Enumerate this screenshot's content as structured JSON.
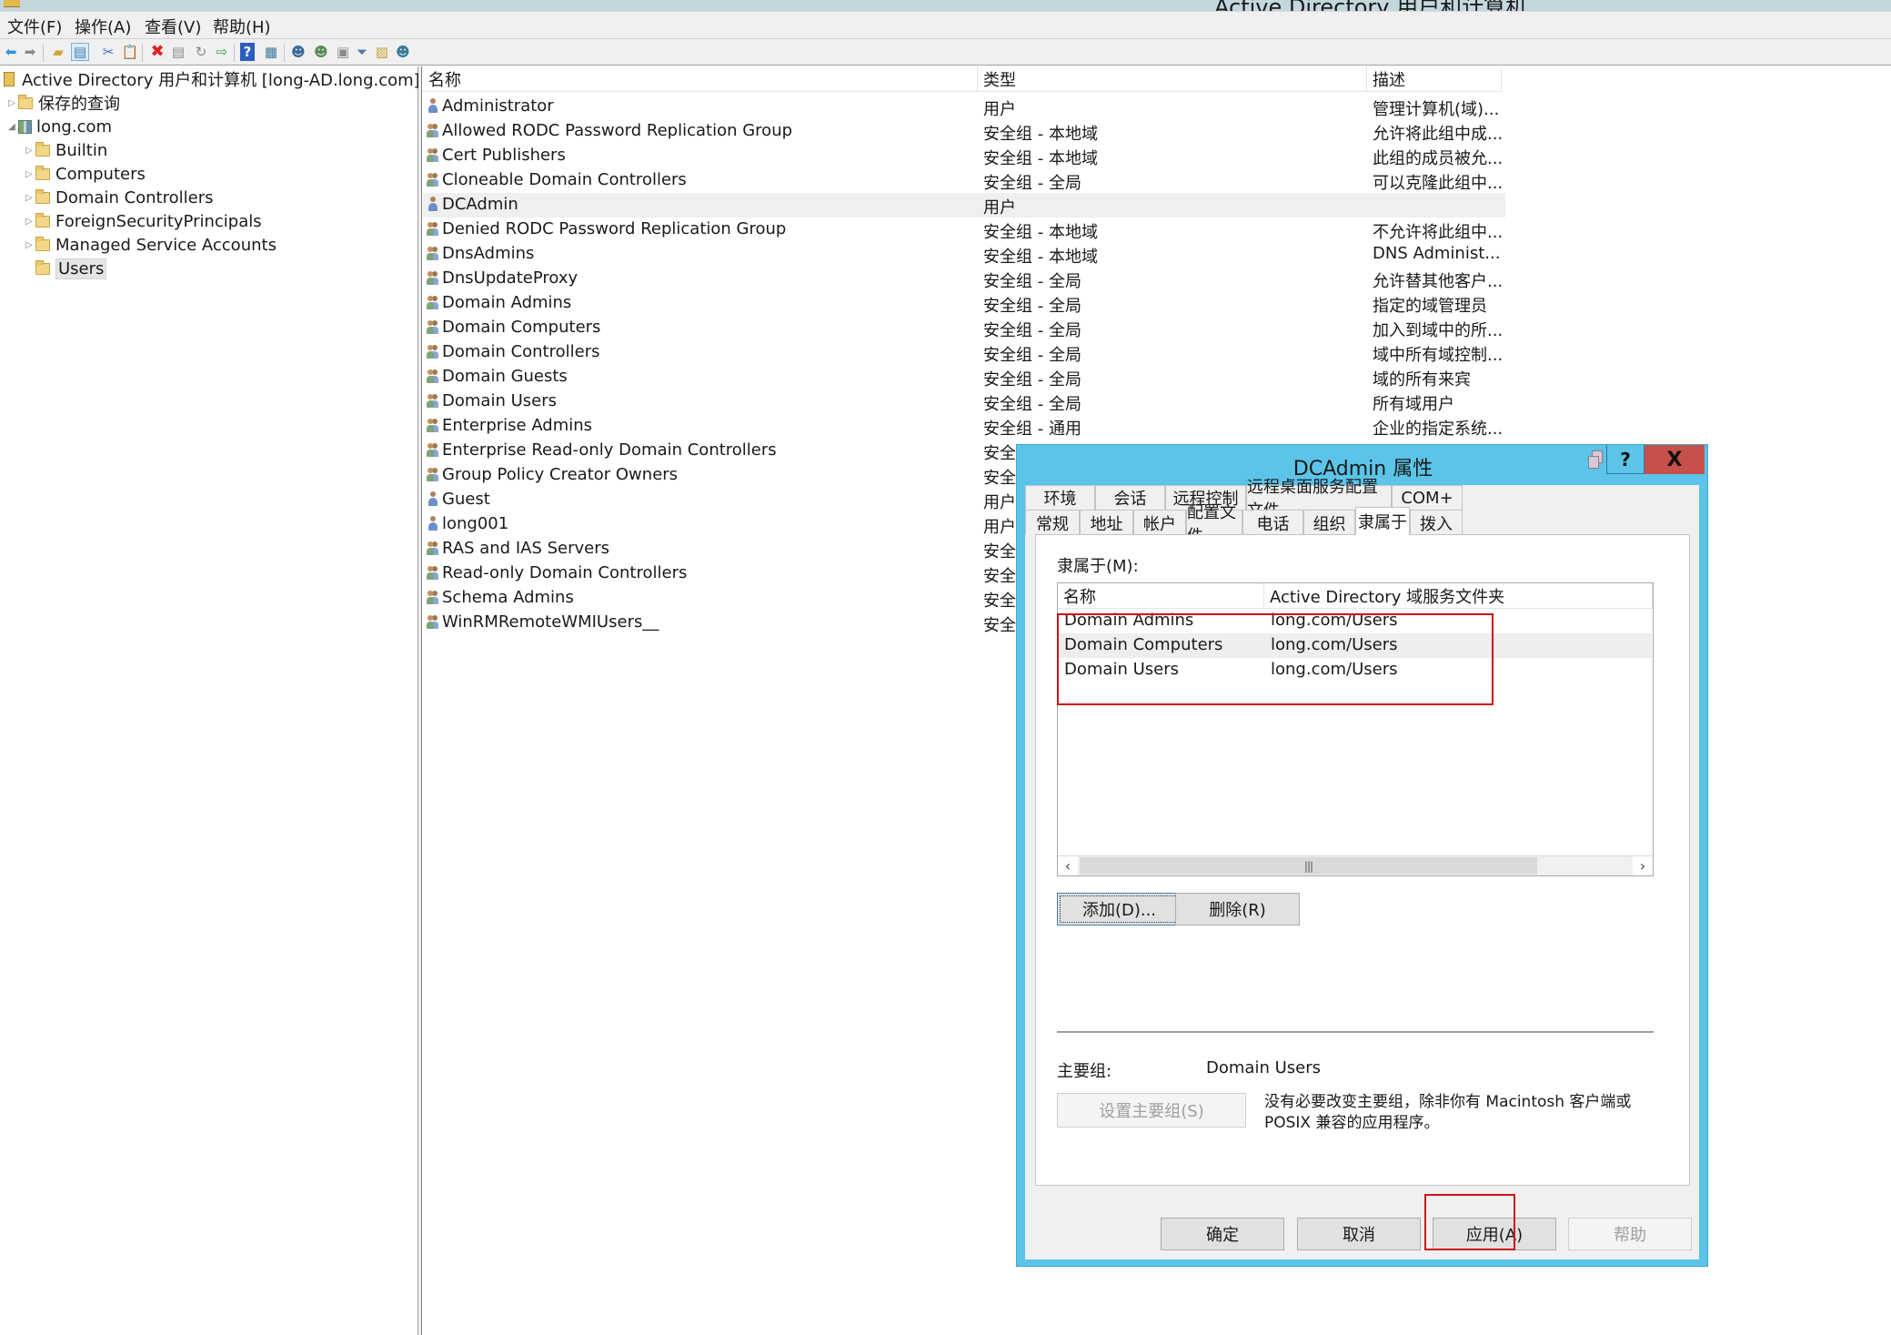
{
  "window": {
    "title": "Active Directory 用户和计算机"
  },
  "menu": [
    "文件(F)",
    "操作(A)",
    "查看(V)",
    "帮助(H)"
  ],
  "toolbar": {
    "icons": [
      "back-icon",
      "forward-icon",
      "up-folder-icon",
      "show-hide-console-tree-icon",
      "cut-icon",
      "paste-icon",
      "delete-icon",
      "properties-icon",
      "refresh-icon",
      "export-list-icon",
      "help-icon",
      "show-action-pane-icon",
      "new-user-icon",
      "new-group-icon",
      "new-ou-icon",
      "filter-icon",
      "find-icon",
      "add-to-group-icon"
    ]
  },
  "tree": {
    "root": "Active Directory 用户和计算机 [long-AD.long.com]",
    "saved_queries": "保存的查询",
    "domain": "long.com",
    "children": [
      "Builtin",
      "Computers",
      "Domain Controllers",
      "ForeignSecurityPrincipals",
      "Managed Service Accounts",
      "Users"
    ],
    "selected": "Users"
  },
  "list": {
    "columns": [
      "名称",
      "类型",
      "描述"
    ],
    "rows": [
      {
        "name": "Administrator",
        "icon": "user",
        "type": "用户",
        "desc": "管理计算机(域)..."
      },
      {
        "name": "Allowed RODC Password Replication Group",
        "icon": "group",
        "type": "安全组 - 本地域",
        "desc": "允许将此组中成..."
      },
      {
        "name": "Cert Publishers",
        "icon": "group",
        "type": "安全组 - 本地域",
        "desc": "此组的成员被允..."
      },
      {
        "name": "Cloneable Domain Controllers",
        "icon": "group",
        "type": "安全组 - 全局",
        "desc": "可以克隆此组中..."
      },
      {
        "name": "DCAdmin",
        "icon": "user",
        "type": "用户",
        "desc": "",
        "selected": true
      },
      {
        "name": "Denied RODC Password Replication Group",
        "icon": "group",
        "type": "安全组 - 本地域",
        "desc": "不允许将此组中..."
      },
      {
        "name": "DnsAdmins",
        "icon": "group",
        "type": "安全组 - 本地域",
        "desc": "DNS Administ..."
      },
      {
        "name": "DnsUpdateProxy",
        "icon": "group",
        "type": "安全组 - 全局",
        "desc": "允许替其他客户..."
      },
      {
        "name": "Domain Admins",
        "icon": "group",
        "type": "安全组 - 全局",
        "desc": "指定的域管理员"
      },
      {
        "name": "Domain Computers",
        "icon": "group",
        "type": "安全组 - 全局",
        "desc": "加入到域中的所..."
      },
      {
        "name": "Domain Controllers",
        "icon": "group",
        "type": "安全组 - 全局",
        "desc": "域中所有域控制..."
      },
      {
        "name": "Domain Guests",
        "icon": "group",
        "type": "安全组 - 全局",
        "desc": "域的所有来宾"
      },
      {
        "name": "Domain Users",
        "icon": "group",
        "type": "安全组 - 全局",
        "desc": "所有域用户"
      },
      {
        "name": "Enterprise Admins",
        "icon": "group",
        "type": "安全组 - 通用",
        "desc": "企业的指定系统..."
      },
      {
        "name": "Enterprise Read-only Domain Controllers",
        "icon": "group",
        "type": "安全",
        "desc": ""
      },
      {
        "name": "Group Policy Creator Owners",
        "icon": "group",
        "type": "安全",
        "desc": ""
      },
      {
        "name": "Guest",
        "icon": "user",
        "type": "用户",
        "desc": ""
      },
      {
        "name": "long001",
        "icon": "user",
        "type": "用户",
        "desc": ""
      },
      {
        "name": "RAS and IAS Servers",
        "icon": "group",
        "type": "安全",
        "desc": ""
      },
      {
        "name": "Read-only Domain Controllers",
        "icon": "group",
        "type": "安全",
        "desc": ""
      },
      {
        "name": "Schema Admins",
        "icon": "group",
        "type": "安全",
        "desc": ""
      },
      {
        "name": "WinRMRemoteWMIUsers__",
        "icon": "group",
        "type": "安全",
        "desc": ""
      }
    ]
  },
  "dialog": {
    "title": "DCAdmin 属性",
    "help_glyph": "?",
    "close_glyph": "X",
    "tabs_row1": [
      "环境",
      "会话",
      "远程控制",
      "远程桌面服务配置文件",
      "COM+"
    ],
    "tabs_row2": [
      "常规",
      "地址",
      "帐户",
      "配置文件",
      "电话",
      "组织",
      "隶属于",
      "拨入"
    ],
    "active_tab": "隶属于",
    "member_of_label": "隶属于(M):",
    "member_columns": [
      "名称",
      "Active Directory 域服务文件夹"
    ],
    "members": [
      {
        "name": "Domain Admins",
        "folder": "long.com/Users"
      },
      {
        "name": "Domain Computers",
        "folder": "long.com/Users"
      },
      {
        "name": "Domain Users",
        "folder": "long.com/Users"
      }
    ],
    "add_button": "添加(D)...",
    "remove_button": "删除(R)",
    "primary_group_label": "主要组:",
    "primary_group_value": "Domain Users",
    "set_primary_button": "设置主要组(S)",
    "note_line1": "没有必要改变主要组，除非你有 Macintosh 客户端或",
    "note_line2": "POSIX 兼容的应用程序。",
    "ok_button": "确定",
    "cancel_button": "取消",
    "apply_button": "应用(A)",
    "help_button": "帮助"
  },
  "annotation_color": "#d0101a"
}
